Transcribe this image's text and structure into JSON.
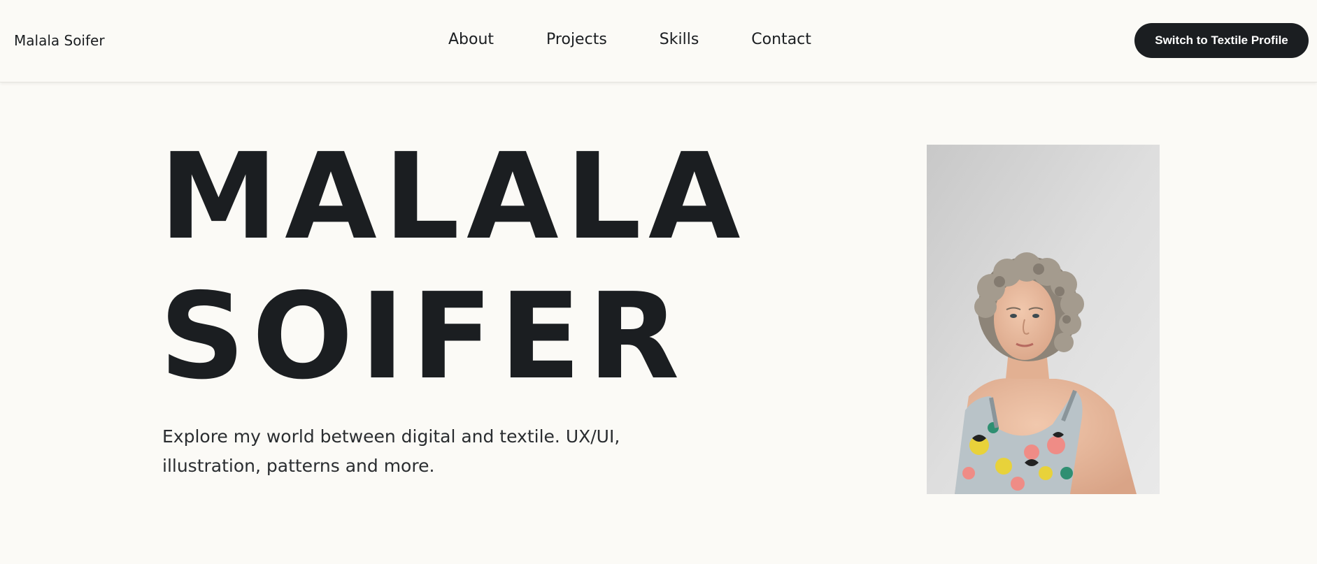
{
  "header": {
    "brand": "Malala Soifer",
    "nav": [
      {
        "label": "About"
      },
      {
        "label": "Projects"
      },
      {
        "label": "Skills"
      },
      {
        "label": "Contact"
      }
    ],
    "switch_button_label": "Switch to Textile Profile"
  },
  "hero": {
    "title_line_1": "MALALA",
    "title_line_2": "SOIFER",
    "tagline": "Explore my world between digital and textile. UX/UI, illustration, patterns and more."
  },
  "portrait": {
    "icon": "portrait-photo"
  },
  "colors": {
    "background": "#fbfaf6",
    "text": "#1b1e21",
    "button_bg": "#1b1e21",
    "button_text": "#ffffff"
  }
}
